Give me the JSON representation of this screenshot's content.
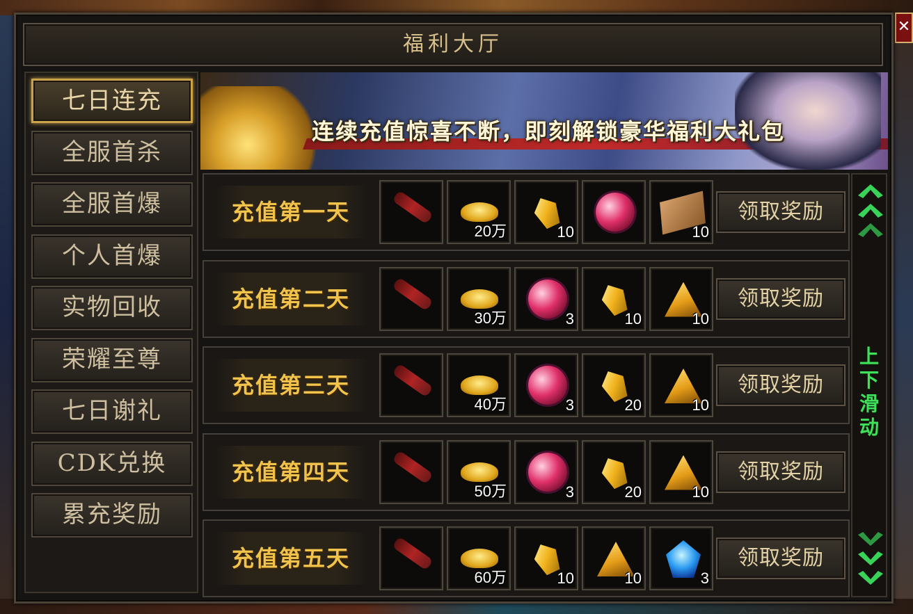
{
  "window": {
    "title": "福利大厅",
    "close_glyph": "✕"
  },
  "sidebar": {
    "items": [
      {
        "label": "七日连充",
        "active": true
      },
      {
        "label": "全服首杀",
        "active": false
      },
      {
        "label": "全服首爆",
        "active": false
      },
      {
        "label": "个人首爆",
        "active": false
      },
      {
        "label": "实物回收",
        "active": false
      },
      {
        "label": "荣耀至尊",
        "active": false
      },
      {
        "label": "七日谢礼",
        "active": false
      },
      {
        "label": "CDK兑换",
        "active": false
      },
      {
        "label": "累充奖励",
        "active": false
      }
    ]
  },
  "banner": {
    "text": "连续充值惊喜不断，即刻解锁豪华福利大礼包"
  },
  "claim_label": "领取奖励",
  "rows": [
    {
      "label": "充值第一天",
      "items": [
        {
          "icon": "scroll-icon",
          "qty": ""
        },
        {
          "icon": "gold-ingot-icon",
          "qty": "20万"
        },
        {
          "icon": "gold-crystal-icon",
          "qty": "10"
        },
        {
          "icon": "red-orb-icon",
          "qty": ""
        },
        {
          "icon": "skill-book-icon",
          "qty": "10"
        }
      ]
    },
    {
      "label": "充值第二天",
      "items": [
        {
          "icon": "scroll-icon",
          "qty": ""
        },
        {
          "icon": "gold-ingot-icon",
          "qty": "30万"
        },
        {
          "icon": "red-orb-icon",
          "qty": "3"
        },
        {
          "icon": "gold-crystal-icon",
          "qty": "10"
        },
        {
          "icon": "gold-pyramid-icon",
          "qty": "10"
        }
      ]
    },
    {
      "label": "充值第三天",
      "items": [
        {
          "icon": "scroll-icon",
          "qty": ""
        },
        {
          "icon": "gold-ingot-icon",
          "qty": "40万"
        },
        {
          "icon": "red-orb-icon",
          "qty": "3"
        },
        {
          "icon": "gold-crystal-icon",
          "qty": "20"
        },
        {
          "icon": "gold-pyramid-icon",
          "qty": "10"
        }
      ]
    },
    {
      "label": "充值第四天",
      "items": [
        {
          "icon": "scroll-icon",
          "qty": ""
        },
        {
          "icon": "gold-ingot-icon",
          "qty": "50万"
        },
        {
          "icon": "red-orb-icon",
          "qty": "3"
        },
        {
          "icon": "gold-crystal-icon",
          "qty": "20"
        },
        {
          "icon": "gold-pyramid-icon",
          "qty": "10"
        }
      ]
    },
    {
      "label": "充值第五天",
      "items": [
        {
          "icon": "scroll-icon",
          "qty": ""
        },
        {
          "icon": "gold-ingot-icon",
          "qty": "60万"
        },
        {
          "icon": "gold-crystal-icon",
          "qty": "10"
        },
        {
          "icon": "gold-pyramid-icon",
          "qty": "10"
        },
        {
          "icon": "blue-gem-icon",
          "qty": "3"
        }
      ]
    }
  ],
  "scroll_hint": {
    "text": "上下滑动",
    "color": "#3fe05a"
  }
}
